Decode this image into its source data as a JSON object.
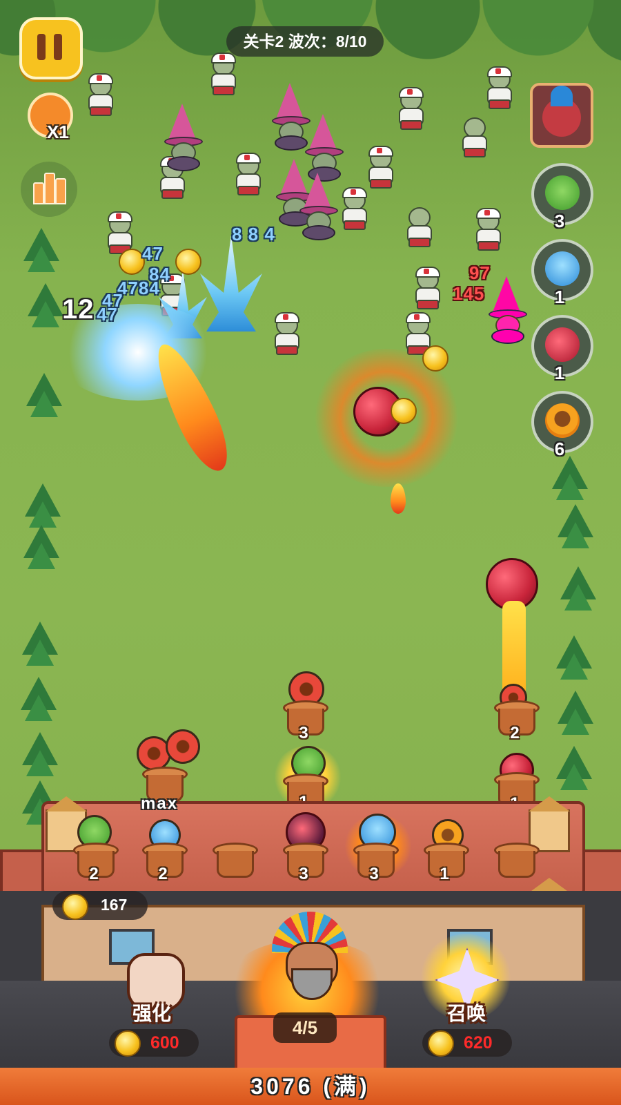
{
  "hud": {
    "level_wave": "关卡2 波次：8/10",
    "speed_label": "X1",
    "coins": "167"
  },
  "icons": {
    "pause": "pause-icon",
    "speed": "alarm-clock-icon",
    "stats": "bar-chart-icon",
    "boss": "boss-portrait-icon"
  },
  "roster": [
    {
      "name": "peashooter",
      "count": "3"
    },
    {
      "name": "blue-mushroom",
      "count": "1"
    },
    {
      "name": "cherry-bomb",
      "count": "1"
    },
    {
      "name": "sunflower",
      "count": "6"
    }
  ],
  "damage_numbers": {
    "d1": "8 8 4",
    "d2": "47",
    "d3": "84",
    "d4": "47",
    "d5": "84",
    "d6": "12",
    "d7": "47",
    "d8": "97",
    "d9": "145",
    "d10": "4784"
  },
  "plants": {
    "row1": [
      "3",
      "2"
    ],
    "row2": [
      "1",
      "1"
    ],
    "row3": [
      "2",
      "2",
      "",
      "3",
      "3",
      "1",
      ""
    ],
    "max_label": "max"
  },
  "actions": {
    "upgrade_label": "强化",
    "upgrade_cost": "600",
    "summon_label": "召唤",
    "summon_cost": "620",
    "hero_count": "4/5",
    "energy_text": "3076 (满)"
  },
  "colors": {
    "cost_red": "#ff2a2a",
    "pause_yellow": "#f7c21f",
    "brick": "#c5604b"
  }
}
